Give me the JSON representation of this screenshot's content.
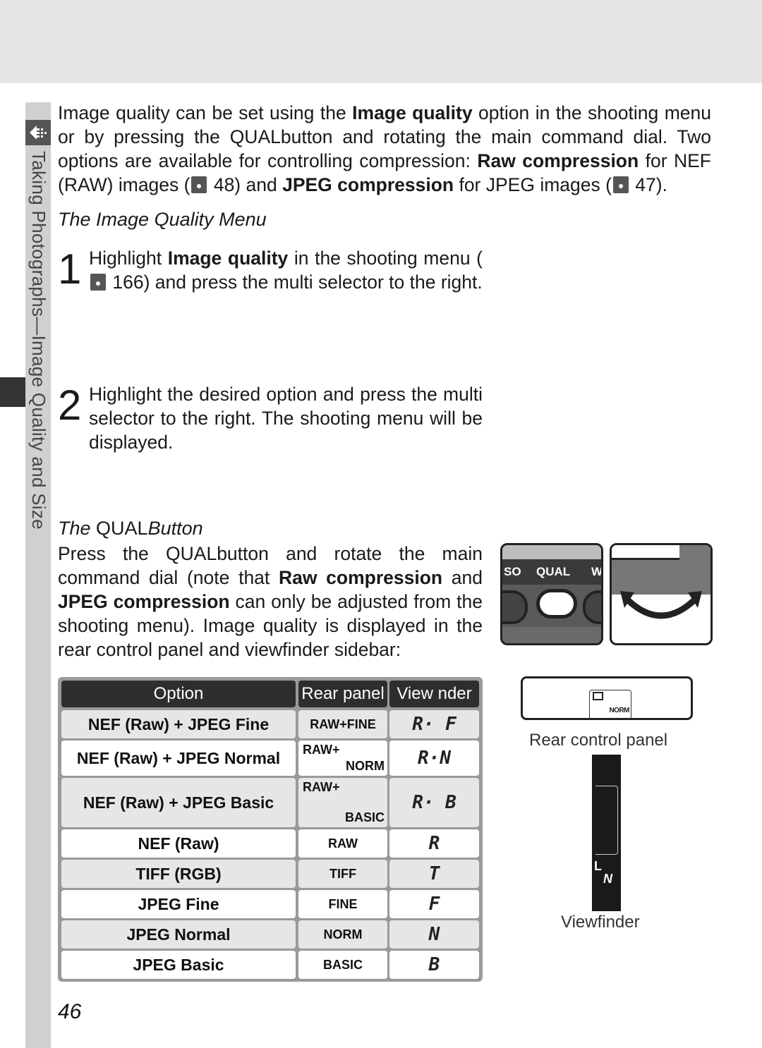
{
  "sidebar": {
    "section_label": "Taking Photographs—Image Quality and Size",
    "icon": "shooting-mode-icon"
  },
  "intro": {
    "line1_a": "Image quality can be set using the ",
    "line1_b": "Image quality",
    "line1_c": " option in the shooting menu or by pressing the ",
    "qual": "QUAL",
    "line2": "button and rotating the main command dial. Two options are available for controlling compression: ",
    "raw_comp": "Raw compression",
    "line3": " for NEF (RAW) images (",
    "ref1": " 48) and ",
    "jpeg_comp": "JPEG compression",
    "line4": " for JPEG images (",
    "ref2": " 47)."
  },
  "menu_section": {
    "heading": "The Image Quality Menu",
    "steps": [
      {
        "num": "1",
        "a": "Highlight ",
        "b": "Image quality",
        "c": " in the shooting menu (",
        "d": " 166) and press the multi selector to the right."
      },
      {
        "num": "2",
        "text": "Highlight the desired option and press the multi selector to the right.  The shooting menu will be displayed."
      }
    ]
  },
  "qual_section": {
    "heading_the": "The ",
    "heading_qual": "QUAL",
    "heading_button": "Button",
    "p_a": "Press the ",
    "p_qual": "QUAL",
    "p_b": "button and rotate the main command dial (note that ",
    "p_raw": "Raw compression",
    "p_c": " and ",
    "p_jpeg": "JPEG compression",
    "p_d": " can only be adjusted from the shooting menu).  Image quality is displayed in the rear control panel and viewfinder sidebar:"
  },
  "illustration": {
    "button_labels": [
      "SO",
      "QUAL",
      "W"
    ],
    "rear_panel_display": "NORM",
    "rear_panel_caption": "Rear control panel",
    "viewfinder_l": "L",
    "viewfinder_n": "N",
    "viewfinder_caption": "Viewfinder"
  },
  "table": {
    "headers": [
      "Option",
      "Rear panel",
      "View  nder"
    ],
    "rows": [
      {
        "option": "NEF (Raw) + JPEG Fine",
        "rear_top": "RAW+FINE",
        "rear_bottom": "",
        "vf": "R· F"
      },
      {
        "option": "NEF (Raw) + JPEG Normal",
        "rear_top": "RAW+",
        "rear_bottom": "NORM",
        "vf": "R·N"
      },
      {
        "option": "NEF (Raw) + JPEG Basic",
        "rear_top": "RAW+",
        "rear_bottom": "BASIC",
        "vf": "R· B"
      },
      {
        "option": "NEF (Raw)",
        "rear_top": "RAW",
        "rear_bottom": "",
        "vf": "R"
      },
      {
        "option": "TIFF (RGB)",
        "rear_top": "TIFF",
        "rear_bottom": "",
        "vf": "T"
      },
      {
        "option": "JPEG Fine",
        "rear_top": "FINE",
        "rear_bottom": "",
        "vf": "F"
      },
      {
        "option": "JPEG Normal",
        "rear_top": "NORM",
        "rear_bottom": "",
        "vf": "N"
      },
      {
        "option": "JPEG Basic",
        "rear_top": "BASIC",
        "rear_bottom": "",
        "vf": "B"
      }
    ]
  },
  "page_number": "46"
}
